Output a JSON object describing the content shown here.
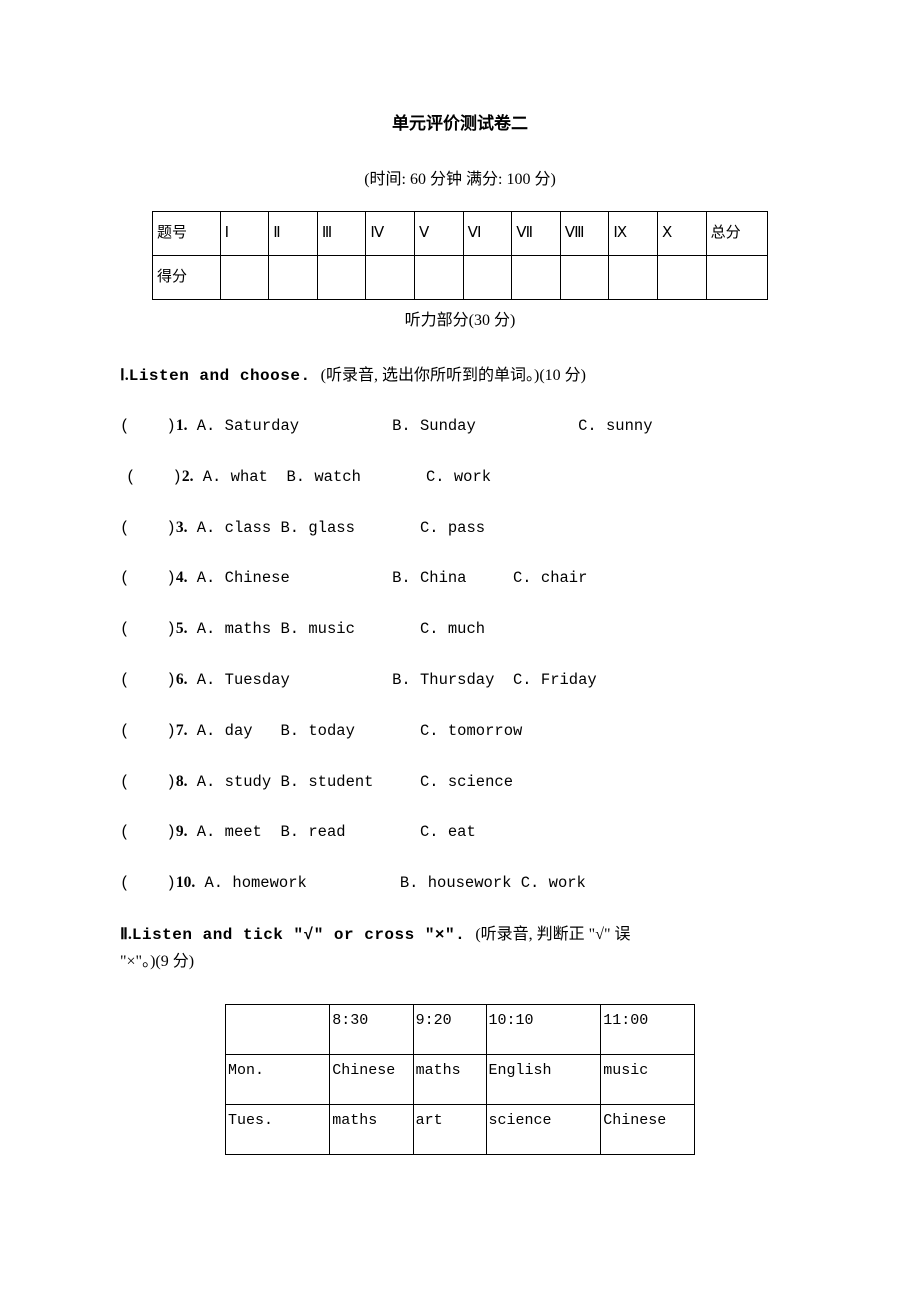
{
  "title": "单元评价测试卷二",
  "meta": "(时间: 60 分钟  满分: 100 分)",
  "score_table": {
    "row1": [
      "题号",
      "Ⅰ",
      "Ⅱ",
      "Ⅲ",
      "Ⅳ",
      "Ⅴ",
      "Ⅵ",
      "Ⅶ",
      "Ⅷ",
      "Ⅸ",
      "Ⅹ",
      "总分"
    ],
    "row2_label": "得分"
  },
  "listening_header": "听力部分(30 分)",
  "section1": {
    "heading_roman": "Ⅰ.",
    "heading_bold": "Listen and choose. ",
    "heading_rest": "(听录音, 选出你所听到的单词。)(10 分)",
    "items": [
      {
        "n": "1",
        "a": "A. Saturday",
        "b": "B. Sunday",
        "c": "C. sunny",
        "layout": "wide"
      },
      {
        "n": "2",
        "a": "A. what",
        "b": "B. watch",
        "c": "C. work",
        "layout": "narrow"
      },
      {
        "n": "3",
        "a": "A. class",
        "b": "B. glass",
        "c": "C. pass",
        "layout": "narrow"
      },
      {
        "n": "4",
        "a": "A. Chinese",
        "b": "B. China",
        "c": "C. chair",
        "layout": "mid"
      },
      {
        "n": "5",
        "a": "A. maths",
        "b": "B. music",
        "c": "C. much",
        "layout": "narrow"
      },
      {
        "n": "6",
        "a": "A. Tuesday",
        "b": "B. Thursday",
        "c": "C. Friday",
        "layout": "mid"
      },
      {
        "n": "7",
        "a": "A. day",
        "b": "B. today",
        "c": "C. tomorrow",
        "layout": "narrow"
      },
      {
        "n": "8",
        "a": "A. study",
        "b": "B. student",
        "c": "C. science",
        "layout": "narrow"
      },
      {
        "n": "9",
        "a": "A. meet",
        "b": "B. read",
        "c": "C. eat",
        "layout": "narrow"
      },
      {
        "n": "10",
        "a": "A. homework",
        "b": "B. housework",
        "c": "C. work",
        "layout": "mid"
      }
    ]
  },
  "section2": {
    "heading_roman": "Ⅱ.",
    "heading_bold": "Listen and tick \"√\" or cross \"×\". ",
    "heading_rest1": "(听录音, 判断正 \"√\" 误",
    "heading_rest2": "\"×\"。)(9 分)",
    "timetable": {
      "header": [
        "",
        "8:30",
        "9:20",
        "10:10",
        "11:00"
      ],
      "rows": [
        [
          "Mon.",
          "Chinese",
          "maths",
          "English",
          "music"
        ],
        [
          "Tues.",
          "maths",
          "art",
          "science",
          "Chinese"
        ]
      ]
    }
  }
}
